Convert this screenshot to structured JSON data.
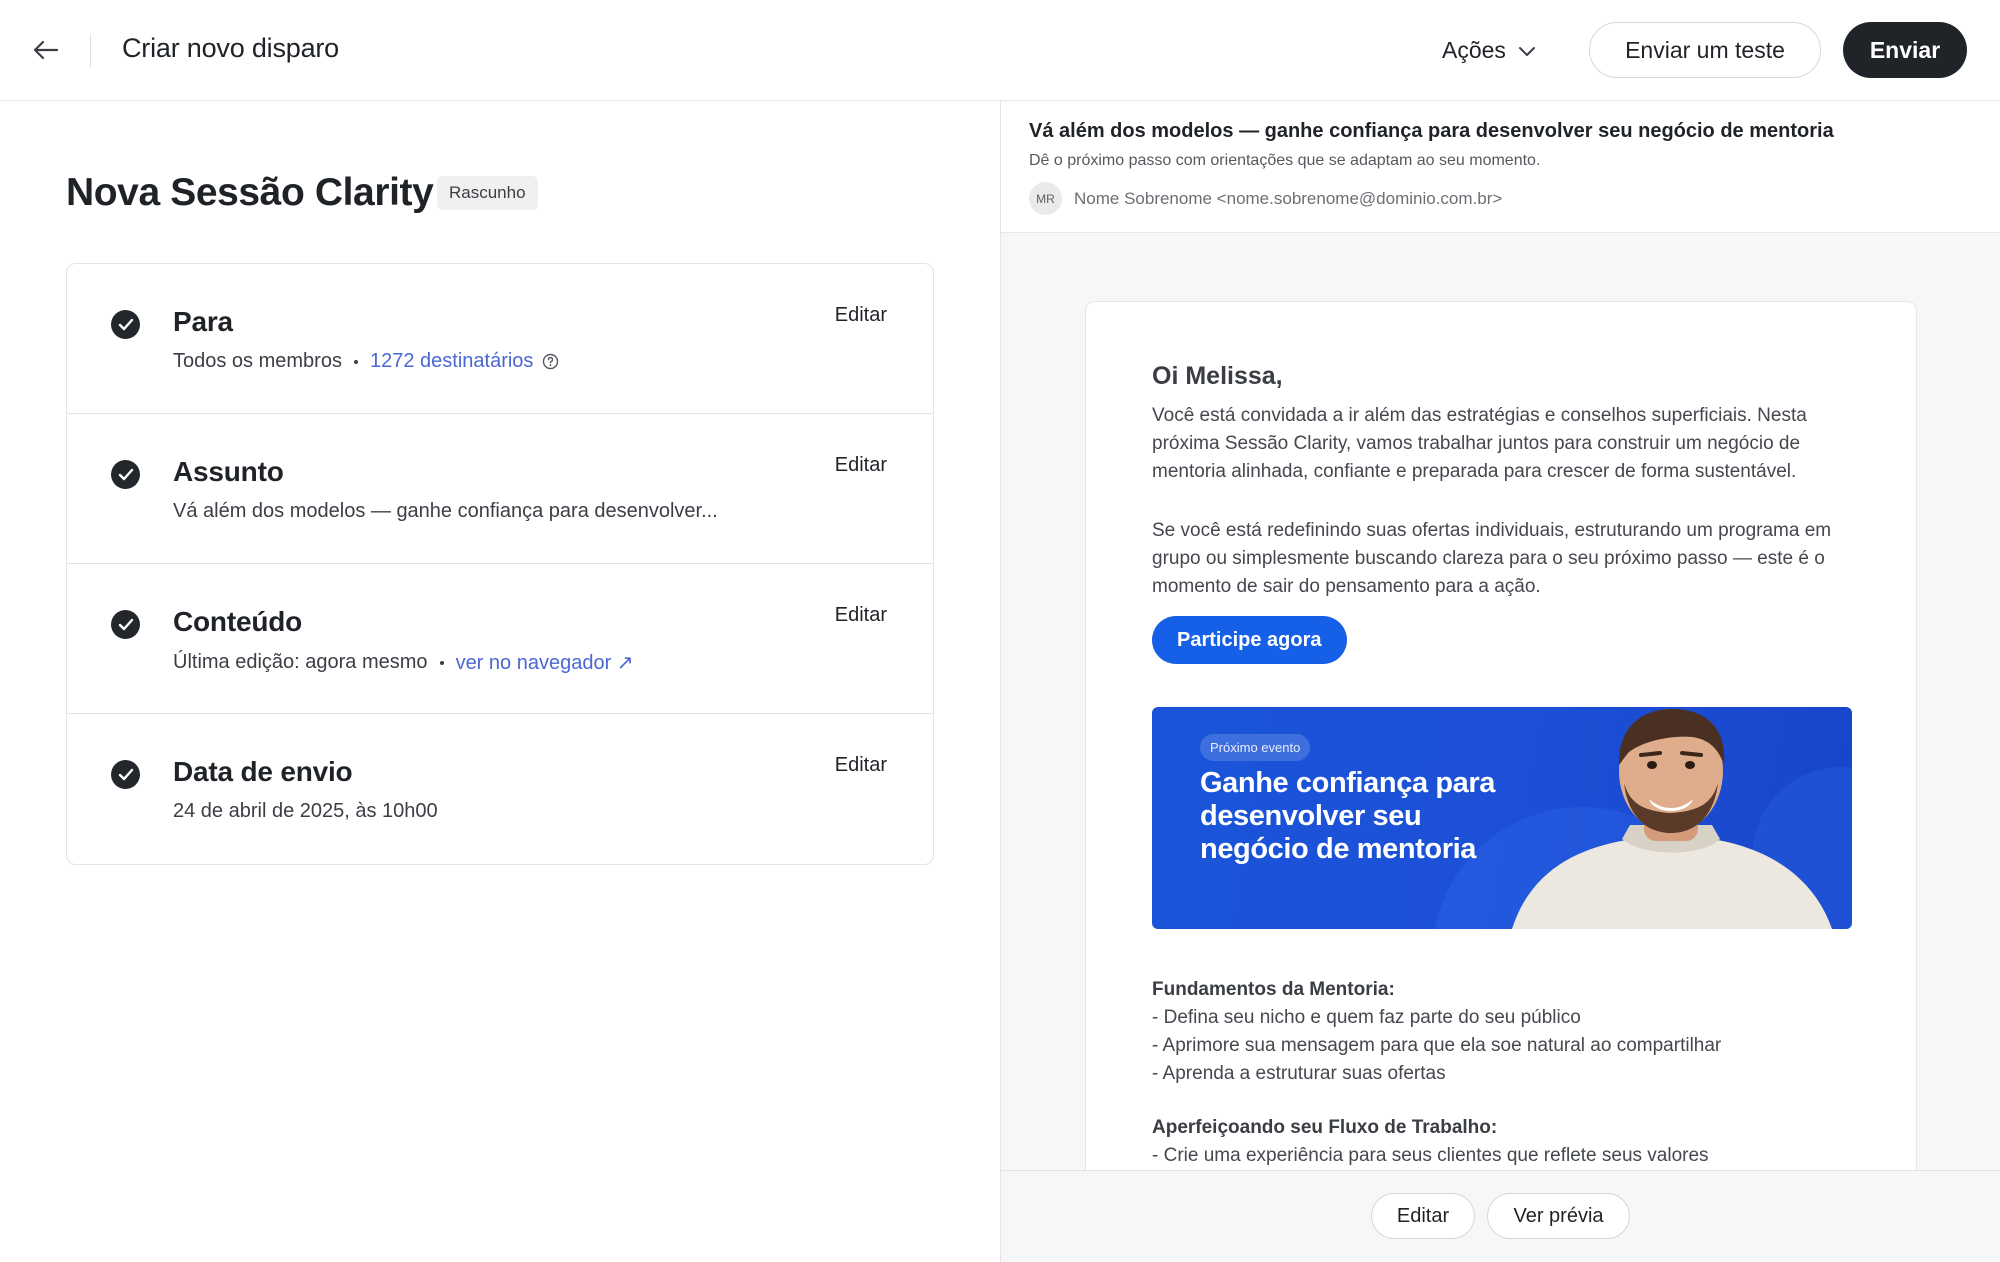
{
  "header": {
    "title": "Criar novo disparo",
    "actions_label": "Ações",
    "send_test_label": "Enviar um teste",
    "send_label": "Enviar"
  },
  "campaign": {
    "title": "Nova Sessão Clarity",
    "status": "Rascunho"
  },
  "steps": [
    {
      "title": "Para",
      "desc": "Todos os membros",
      "link": "1272 destinatários",
      "edit": "Editar"
    },
    {
      "title": "Assunto",
      "desc": "Vá além dos modelos — ganhe confiança para desenvolver...",
      "edit": "Editar"
    },
    {
      "title": "Conteúdo",
      "desc": "Última edição: agora mesmo",
      "link": "ver no navegador ↗",
      "edit": "Editar"
    },
    {
      "title": "Data de envio",
      "desc": "24 de abril de 2025, às 10h00",
      "edit": "Editar"
    }
  ],
  "preview": {
    "subject": "Vá além dos modelos — ganhe confiança para desenvolver seu negócio de mentoria",
    "preheader": "Dê o próximo passo com orientações que se adaptam ao seu momento.",
    "sender_initials": "MR",
    "sender": "Nome Sobrenome <nome.sobrenome@dominio.com.br>",
    "email": {
      "greeting": "Oi Melissa,",
      "paragraph1": "Você está convidada a ir além das estratégias e conselhos superficiais. Nesta próxima Sessão Clarity, vamos trabalhar juntos para construir um negócio de mentoria alinhada, confiante e preparada para crescer de forma sustentável.",
      "paragraph2": "Se você está redefinindo suas ofertas individuais, estruturando um programa em grupo ou simplesmente buscando clareza para o seu próximo passo — este é o momento de sair do pensamento para a ação.",
      "cta": "Participe agora",
      "banner": {
        "pill": "Próximo evento",
        "headline": "Ganhe confiança para desenvolver seu negócio de mentoria"
      },
      "section1": {
        "heading": "Fundamentos da Mentoria:",
        "items": [
          "- Defina seu nicho e quem faz parte do seu público",
          "- Aprimore sua mensagem para que ela soe natural ao compartilhar",
          "- Aprenda a estruturar suas ofertas"
        ]
      },
      "section2": {
        "heading": "Aperfeiçoando seu Fluxo de Trabalho:",
        "items": [
          "- Crie uma experiência para seus clientes que reflete seus valores"
        ]
      }
    },
    "footer": {
      "edit_label": "Editar",
      "preview_label": "Ver prévia"
    }
  },
  "colors": {
    "primary_dark": "#202429",
    "link": "#4a67d6",
    "cta_blue": "#1660e8",
    "banner_blue": "#1a55d9"
  }
}
